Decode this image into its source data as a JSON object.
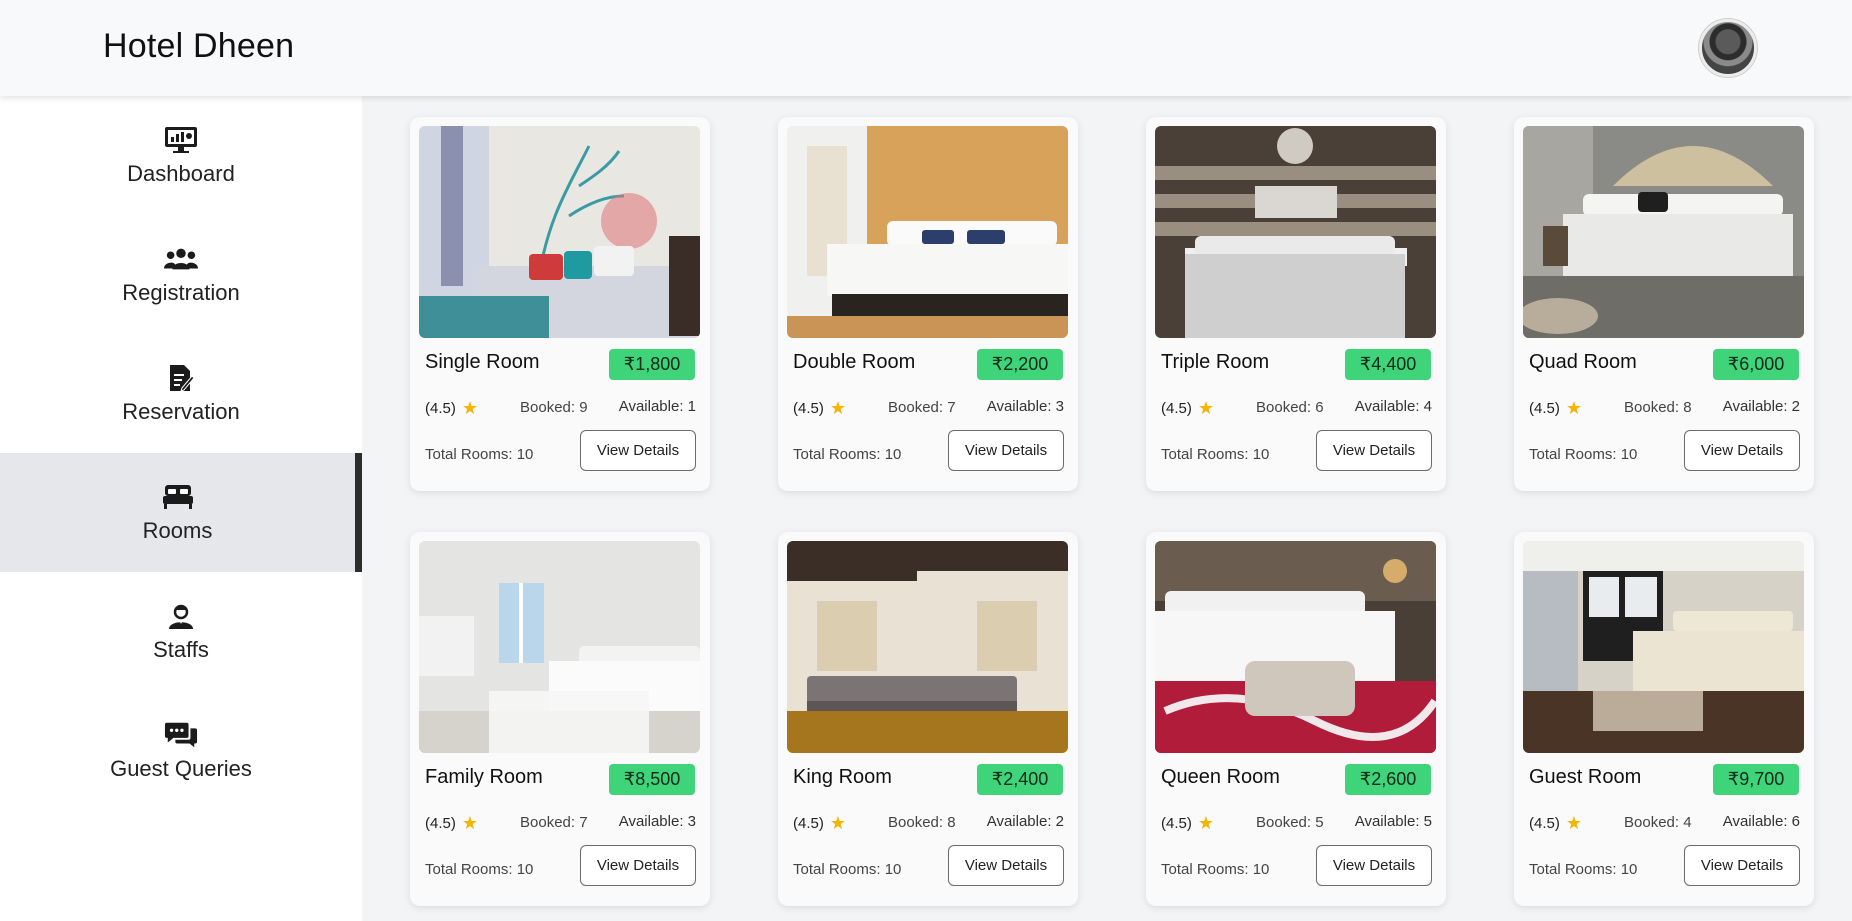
{
  "app": {
    "title": "Hotel Dheen"
  },
  "header": {
    "avatar_alt": "user-avatar"
  },
  "sidebar": {
    "items": [
      {
        "label": "Dashboard",
        "icon": "dashboard-monitor-icon"
      },
      {
        "label": "Registration",
        "icon": "users-group-icon"
      },
      {
        "label": "Reservation",
        "icon": "file-edit-icon"
      },
      {
        "label": "Rooms",
        "icon": "bed-icon",
        "active": true
      },
      {
        "label": "Staffs",
        "icon": "staff-user-icon"
      },
      {
        "label": "Guest Queries",
        "icon": "chat-bubbles-icon"
      }
    ]
  },
  "rooms": [
    {
      "name": "Single Room",
      "price": "₹1,800",
      "rating": "(4.5)",
      "booked": "Booked: 9",
      "available": "Available: 1",
      "total": "Total Rooms: 10",
      "button": "View Details"
    },
    {
      "name": "Double Room",
      "price": "₹2,200",
      "rating": "(4.5)",
      "booked": "Booked: 7",
      "available": "Available: 3",
      "total": "Total Rooms: 10",
      "button": "View Details"
    },
    {
      "name": "Triple Room",
      "price": "₹4,400",
      "rating": "(4.5)",
      "booked": "Booked: 6",
      "available": "Available: 4",
      "total": "Total Rooms: 10",
      "button": "View Details"
    },
    {
      "name": "Quad Room",
      "price": "₹6,000",
      "rating": "(4.5)",
      "booked": "Booked: 8",
      "available": "Available: 2",
      "total": "Total Rooms: 10",
      "button": "View Details"
    },
    {
      "name": "Family Room",
      "price": "₹8,500",
      "rating": "(4.5)",
      "booked": "Booked: 7",
      "available": "Available: 3",
      "total": "Total Rooms: 10",
      "button": "View Details"
    },
    {
      "name": "King Room",
      "price": "₹2,400",
      "rating": "(4.5)",
      "booked": "Booked: 8",
      "available": "Available: 2",
      "total": "Total Rooms: 10",
      "button": "View Details"
    },
    {
      "name": "Queen Room",
      "price": "₹2,600",
      "rating": "(4.5)",
      "booked": "Booked: 5",
      "available": "Available: 5",
      "total": "Total Rooms: 10",
      "button": "View Details"
    },
    {
      "name": "Guest Room",
      "price": "₹9,700",
      "rating": "(4.5)",
      "booked": "Booked: 4",
      "available": "Available: 6",
      "total": "Total Rooms: 10",
      "button": "View Details"
    }
  ],
  "colors": {
    "price_badge": "#3fd37a",
    "star": "#f4b400",
    "active_nav_bg": "#e5e7eb",
    "active_nav_border": "#2d2d2d"
  }
}
